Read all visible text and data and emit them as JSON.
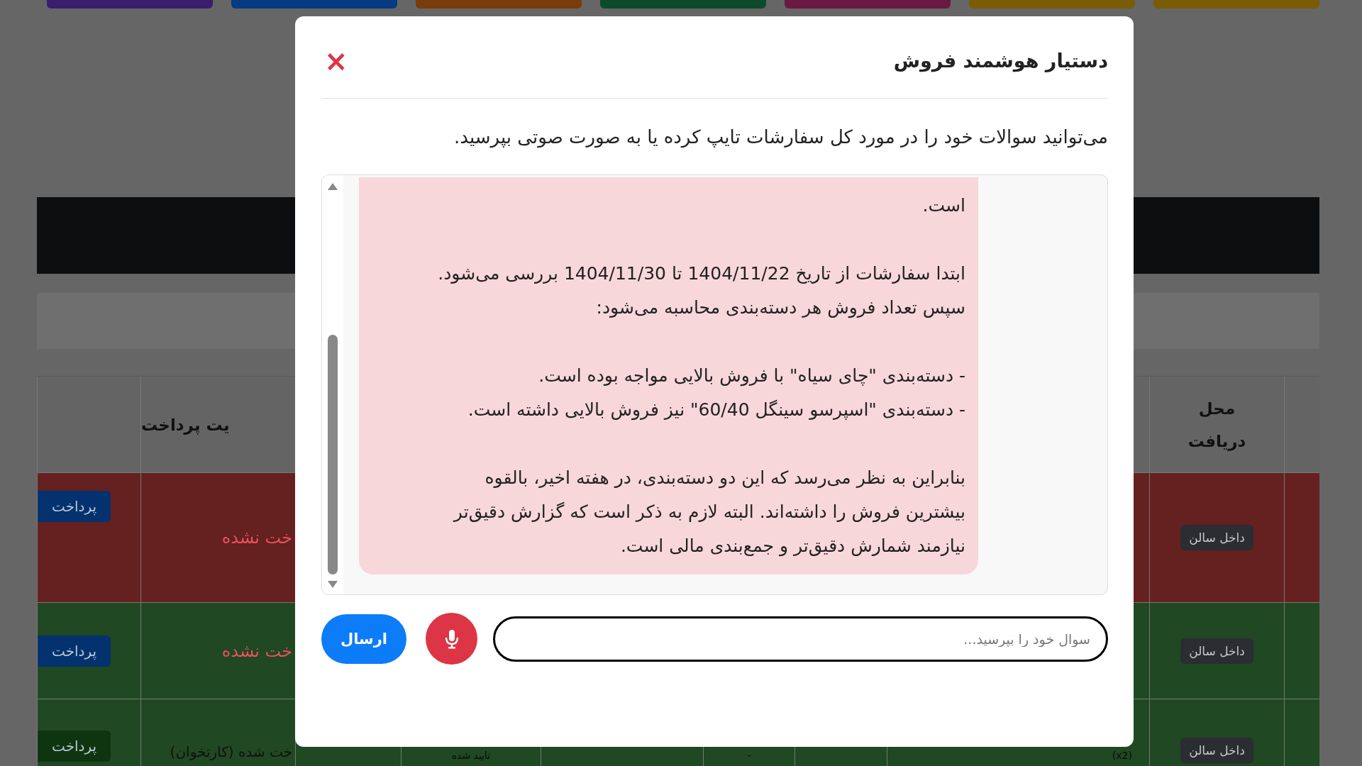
{
  "nav_tabs": [
    {
      "color": "#3a1e6e"
    },
    {
      "color": "#063a82"
    },
    {
      "color": "#7a3c0a"
    },
    {
      "color": "#0d4a2c"
    },
    {
      "color": "#6a1a42"
    },
    {
      "color": "#7a5c05"
    },
    {
      "color": "#7a5c05"
    }
  ],
  "table": {
    "headers": {
      "payment_status": "یت پرداخت",
      "pickup": "محل دریافت"
    },
    "rows": [
      {
        "color": "#652020",
        "pay_button": {
          "label": "پرداخت",
          "color": "#03326e"
        },
        "payment_status": "خت نشده",
        "pickup": "داخل سالن"
      },
      {
        "color": "#204822",
        "pay_button": {
          "label": "پرداخت",
          "color": "#03326e"
        },
        "payment_status": "خت نشده",
        "pickup": "داخل سالن"
      },
      {
        "color": "#204822",
        "pay_button": {
          "label": "پرداخت",
          "color": "#0e3510"
        },
        "payment_status": "خت شده (کارتخوان)",
        "column_3": "تایید شده",
        "column_5": "-",
        "column_7": "(x2)",
        "pickup": "داخل سالن"
      }
    ]
  },
  "modal": {
    "title": "دستیار هوشمند فروش",
    "close": "×",
    "subtitle": "می‌توانید سوالات خود را در مورد کل سفارشات تایپ کرده یا به صورت صوتی بپرسید.",
    "message": [
      "است.",
      "ابتدا سفارشات از تاریخ 1404/11/22 تا 1404/11/30 بررسی می‌شود.\nسپس تعداد فروش هر دسته‌بندی محاسبه می‌شود:",
      "- دسته‌بندی \"چای سیاه\" با فروش بالایی مواجه بوده است.\n- دسته‌بندی \"اسپرسو سینگل 60/40\" نیز فروش بالایی داشته است.",
      "بنابراین به نظر می‌رسد که این دو دسته‌بندی، در هفته اخیر، بالقوه\nبیشترین فروش را داشته‌اند. البته لازم به ذکر است که گزارش دقیق‌تر\nنیازمند شمارش دقیق‌تر و جمع‌بندی مالی است."
    ],
    "input": {
      "placeholder": "سوال خود را بپرسید..."
    },
    "send_button": "ارسال"
  }
}
